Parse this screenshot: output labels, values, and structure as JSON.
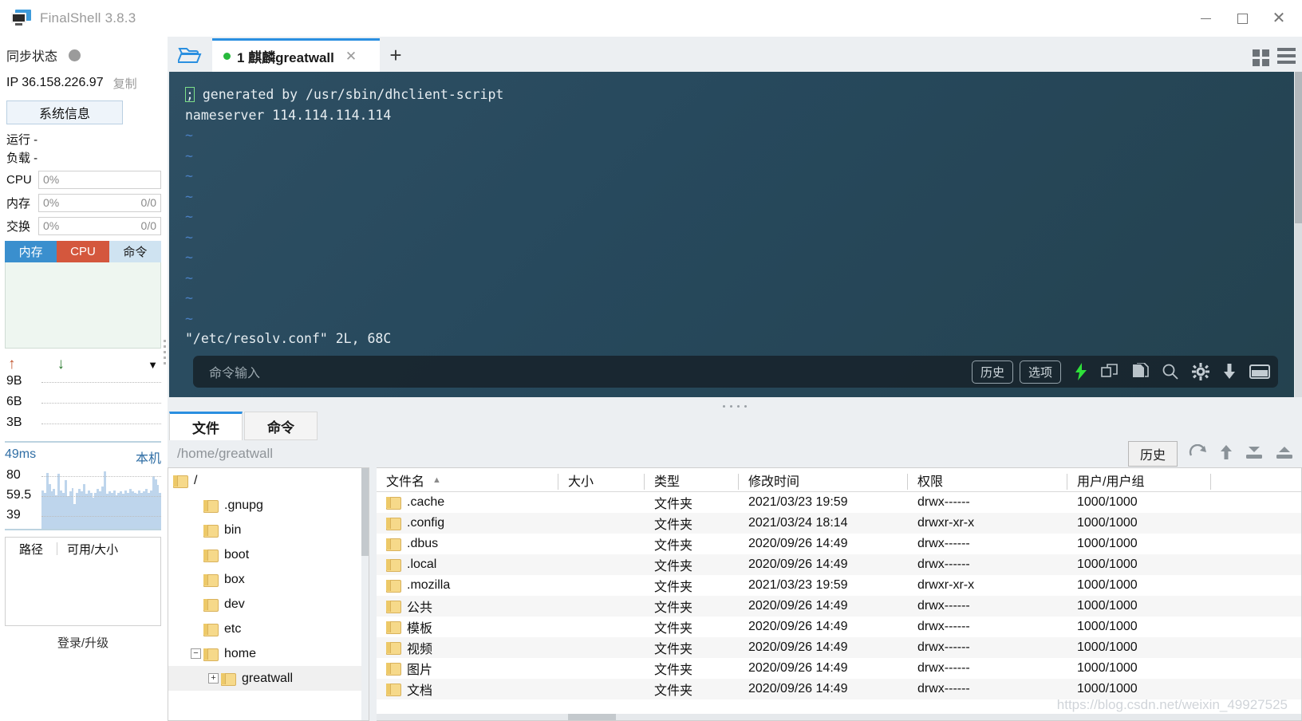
{
  "window": {
    "title": "FinalShell 3.8.3",
    "minimize": "—",
    "maximize": "□",
    "close": "✕"
  },
  "sidebar": {
    "sync_label": "同步状态",
    "ip_label": "IP 36.158.226.97",
    "copy_label": "复制",
    "sysinfo_button": "系统信息",
    "uptime_label": "运行 -",
    "load_label": "负载 -",
    "stats": [
      {
        "name": "CPU",
        "percent": "0%",
        "detail": ""
      },
      {
        "name": "内存",
        "percent": "0%",
        "detail": "0/0"
      },
      {
        "name": "交换",
        "percent": "0%",
        "detail": "0/0"
      }
    ],
    "mini_tabs": [
      {
        "label": "内存",
        "color": "#3a8fce"
      },
      {
        "label": "CPU",
        "color": "#d4573d"
      },
      {
        "label": "命令",
        "color": "#cfe3f1"
      }
    ],
    "net_graph": {
      "up_arrow": "↑",
      "down_arrow": "↓",
      "caret": "▼",
      "y_labels": [
        "9B",
        "6B",
        "3B"
      ]
    },
    "latency": {
      "value": "49ms",
      "host_label": "本机",
      "y_labels": [
        "80",
        "59.5",
        "39"
      ]
    },
    "disk": {
      "col_path": "路径",
      "col_avail": "可用/大小"
    },
    "login_upgrade": "登录/升级"
  },
  "tabstrip": {
    "folder_icon": "folder-open-icon",
    "tabs": [
      {
        "index": "1",
        "label": "1 麒麟greatwall",
        "status": "connected",
        "close": "✕"
      }
    ],
    "add_tab": "+",
    "grid_view_icon": "grid-view-icon",
    "list_view_icon": "list-view-icon"
  },
  "terminal": {
    "lines": [
      "; generated by /usr/sbin/dhclient-script",
      "nameserver 114.114.114.114",
      "~",
      "~",
      "~",
      "~",
      "~",
      "~",
      "~",
      "~",
      "~",
      "~",
      "\"/etc/resolv.conf\" 2L, 68C"
    ],
    "first_line_prefix": ";",
    "first_line_rest": " generated by /usr/sbin/dhclient-script",
    "nameserver_line": "nameserver 114.114.114.114",
    "tilde": "~",
    "status_line": "\"/etc/resolv.conf\" 2L, 68C"
  },
  "command_bar": {
    "placeholder": "命令输入",
    "history_button": "历史",
    "options_button": "选项",
    "icons": [
      "lightning-icon",
      "copy-icon",
      "paste-icon",
      "search-icon",
      "gear-icon",
      "download-icon",
      "window-icon"
    ]
  },
  "file_panel": {
    "tabs": [
      {
        "label": "文件",
        "active": true
      },
      {
        "label": "命令",
        "active": false
      }
    ],
    "path": "/home/greatwall",
    "history_button": "历史",
    "toolbar_icons": [
      "refresh-icon",
      "up-level-icon",
      "download-icon",
      "upload-icon"
    ],
    "tree": [
      {
        "label": "/",
        "depth": 0,
        "expander": ""
      },
      {
        "label": ".gnupg",
        "depth": 1,
        "expander": ""
      },
      {
        "label": "bin",
        "depth": 1,
        "expander": ""
      },
      {
        "label": "boot",
        "depth": 1,
        "expander": ""
      },
      {
        "label": "box",
        "depth": 1,
        "expander": ""
      },
      {
        "label": "dev",
        "depth": 1,
        "expander": ""
      },
      {
        "label": "etc",
        "depth": 1,
        "expander": ""
      },
      {
        "label": "home",
        "depth": 1,
        "expander": "−"
      },
      {
        "label": "greatwall",
        "depth": 2,
        "expander": "+"
      }
    ],
    "columns": [
      {
        "key": "name",
        "label": "文件名",
        "sorted": "asc"
      },
      {
        "key": "size",
        "label": "大小"
      },
      {
        "key": "type",
        "label": "类型"
      },
      {
        "key": "time",
        "label": "修改时间"
      },
      {
        "key": "perm",
        "label": "权限"
      },
      {
        "key": "user",
        "label": "用户/用户组"
      }
    ],
    "rows": [
      {
        "name": ".cache",
        "size": "",
        "type": "文件夹",
        "time": "2021/03/23 19:59",
        "perm": "drwx------",
        "user": "1000/1000"
      },
      {
        "name": ".config",
        "size": "",
        "type": "文件夹",
        "time": "2021/03/24 18:14",
        "perm": "drwxr-xr-x",
        "user": "1000/1000"
      },
      {
        "name": ".dbus",
        "size": "",
        "type": "文件夹",
        "time": "2020/09/26 14:49",
        "perm": "drwx------",
        "user": "1000/1000"
      },
      {
        "name": ".local",
        "size": "",
        "type": "文件夹",
        "time": "2020/09/26 14:49",
        "perm": "drwx------",
        "user": "1000/1000"
      },
      {
        "name": ".mozilla",
        "size": "",
        "type": "文件夹",
        "time": "2021/03/23 19:59",
        "perm": "drwxr-xr-x",
        "user": "1000/1000"
      },
      {
        "name": "公共",
        "size": "",
        "type": "文件夹",
        "time": "2020/09/26 14:49",
        "perm": "drwx------",
        "user": "1000/1000"
      },
      {
        "name": "模板",
        "size": "",
        "type": "文件夹",
        "time": "2020/09/26 14:49",
        "perm": "drwx------",
        "user": "1000/1000"
      },
      {
        "name": "视频",
        "size": "",
        "type": "文件夹",
        "time": "2020/09/26 14:49",
        "perm": "drwx------",
        "user": "1000/1000"
      },
      {
        "name": "图片",
        "size": "",
        "type": "文件夹",
        "time": "2020/09/26 14:49",
        "perm": "drwx------",
        "user": "1000/1000"
      },
      {
        "name": "文档",
        "size": "",
        "type": "文件夹",
        "time": "2020/09/26 14:49",
        "perm": "drwx------",
        "user": "1000/1000"
      }
    ]
  },
  "watermark": "https://blog.csdn.net/weixin_49927525",
  "colors": {
    "accent": "#2a8fe0",
    "terminal_bg": "#27495d",
    "mem_tab": "#3a8fce",
    "cpu_tab": "#d4573d",
    "status_dot": "#28b93c"
  }
}
